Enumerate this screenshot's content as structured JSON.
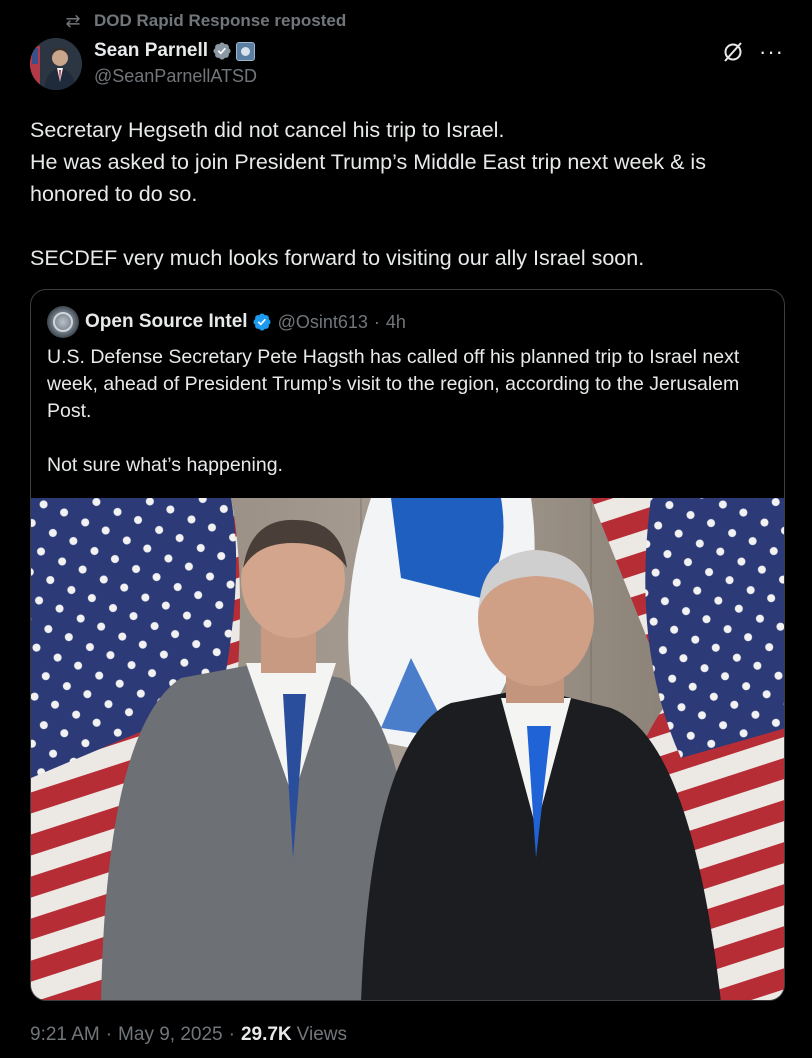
{
  "repost": {
    "icon": "repost-icon",
    "text": "DOD Rapid Response reposted"
  },
  "post": {
    "display_name": "Sean Parnell",
    "handle": "@SeanParnellATSD",
    "badges": [
      "verified-check-icon",
      "government-affiliation-badge"
    ],
    "text_lines": [
      "Secretary Hegseth did not cancel his trip to Israel.",
      "He was asked to join President Trump’s Middle East trip next week & is honored to do so.",
      "SECDEF very much looks forward to visiting our ally Israel soon."
    ]
  },
  "quote": {
    "display_name": "Open Source Intel",
    "handle": "@Osint613",
    "separator": "·",
    "age": "4h",
    "text_lines": [
      "U.S. Defense Secretary Pete Hagsth has called off his planned trip to Israel next week, ahead of President Trump’s visit to the region, according to the Jerusalem Post.",
      "Not sure what’s happening."
    ]
  },
  "meta": {
    "time": "9:21 AM",
    "sep1": "·",
    "date": "May 9, 2025",
    "sep2": "·",
    "views_count": "29.7K",
    "views_label": "Views"
  },
  "colors": {
    "background": "#000000",
    "text": "#e7e9ea",
    "muted": "#71767b",
    "verified": "#1d9bf0",
    "border": "#3a3e42"
  }
}
